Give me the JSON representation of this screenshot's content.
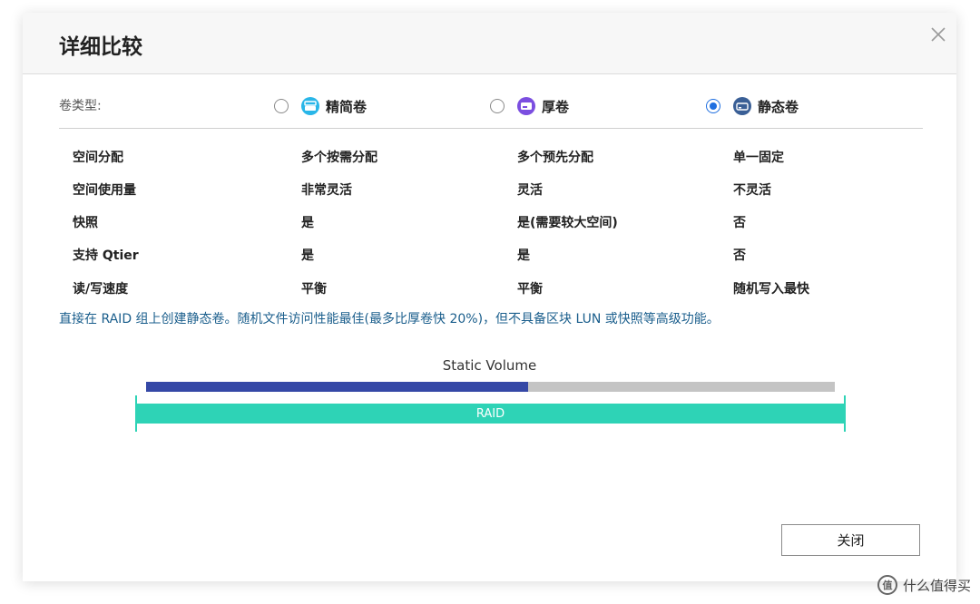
{
  "dialog": {
    "title": "详细比较",
    "volume_type_label": "卷类型:",
    "options": [
      {
        "label": "精简卷",
        "checked": false,
        "icon": "thin-volume-icon",
        "icon_color": "#29b6e8"
      },
      {
        "label": "厚卷",
        "checked": false,
        "icon": "thick-volume-icon",
        "icon_color": "#7b4ee0"
      },
      {
        "label": "静态卷",
        "checked": true,
        "icon": "static-volume-icon",
        "icon_color": "#3a5f96"
      }
    ],
    "rows": [
      {
        "cells": [
          "空间分配",
          "多个按需分配",
          "多个预先分配",
          "单一固定"
        ]
      },
      {
        "cells": [
          "空间使用量",
          "非常灵活",
          "灵活",
          "不灵活"
        ]
      },
      {
        "cells": [
          "快照",
          "是",
          "是(需要较大空间)",
          "否"
        ]
      },
      {
        "cells": [
          "支持 Qtier",
          "是",
          "是",
          "否"
        ]
      },
      {
        "cells": [
          "读/写速度",
          "平衡",
          "平衡",
          "随机写入最快"
        ]
      }
    ],
    "description": "直接在 RAID 组上创建静态卷。随机文件访问性能最佳(最多比厚卷快 20%)，但不具备区块 LUN 或快照等高级功能。",
    "diagram": {
      "volume_label": "Static Volume",
      "raid_label": "RAID",
      "volume_fill_fraction": 0.555,
      "colors": {
        "volume": "#3548a6",
        "track": "#c4c4c4",
        "raid": "#2ed3b6"
      }
    },
    "close_button": "关闭"
  },
  "watermark": {
    "text": "什么值得买",
    "logo_glyph": "值"
  }
}
